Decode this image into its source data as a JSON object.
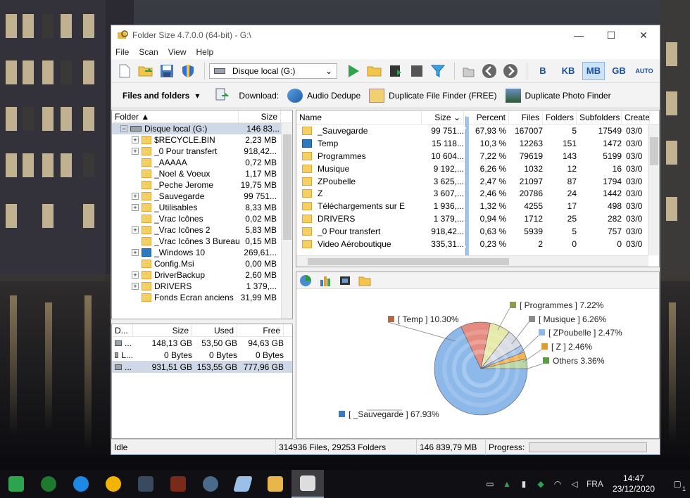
{
  "window": {
    "title": "Folder Size 4.7.0.0 (64-bit) - G:\\",
    "minimize": "—",
    "maximize": "☐",
    "close": "✕"
  },
  "menu": [
    "File",
    "Scan",
    "View",
    "Help"
  ],
  "toolbar": {
    "drive_selected": "Disque local (G:)",
    "units": [
      "B",
      "KB",
      "MB",
      "GB",
      "AUTO"
    ],
    "active_unit": "MB"
  },
  "subbar": {
    "view_label": "Files and folders",
    "download_label": "Download:",
    "links": [
      "Audio Dedupe",
      "Duplicate File Finder (FREE)",
      "Duplicate Photo Finder"
    ]
  },
  "tree": {
    "headers": {
      "folder": "Folder",
      "size": "Size"
    },
    "root": {
      "name": "Disque local (G:)",
      "size": "146 83..."
    },
    "items": [
      {
        "name": "$RECYCLE.BIN",
        "size": "2,23 MB",
        "exp": true,
        "blue": false
      },
      {
        "name": "_0 Pour transfert",
        "size": "918,42...",
        "exp": true,
        "blue": false
      },
      {
        "name": "_AAAAA",
        "size": "0,72 MB",
        "exp": false,
        "blue": false
      },
      {
        "name": "_Noel & Voeux",
        "size": "1,17 MB",
        "exp": false,
        "blue": false
      },
      {
        "name": "_Peche Jerome",
        "size": "19,75 MB",
        "exp": false,
        "blue": false
      },
      {
        "name": "_Sauvegarde",
        "size": "99 751...",
        "exp": true,
        "blue": false
      },
      {
        "name": "_Utilisables",
        "size": "8,33 MB",
        "exp": true,
        "blue": false
      },
      {
        "name": "_Vrac Icônes",
        "size": "0,02 MB",
        "exp": false,
        "blue": false
      },
      {
        "name": "_Vrac Icônes 2",
        "size": "5,83 MB",
        "exp": true,
        "blue": false
      },
      {
        "name": "_Vrac Icônes 3 Bureau",
        "size": "0,15 MB",
        "exp": false,
        "blue": false
      },
      {
        "name": "_Windows 10",
        "size": "269,61...",
        "exp": true,
        "blue": true
      },
      {
        "name": "Config.Msi",
        "size": "0,00 MB",
        "exp": false,
        "blue": false
      },
      {
        "name": "DriverBackup",
        "size": "2,60 MB",
        "exp": true,
        "blue": false
      },
      {
        "name": "DRIVERS",
        "size": "1 379,...",
        "exp": true,
        "blue": false
      },
      {
        "name": "Fonds Ecran anciens",
        "size": "31,99 MB",
        "exp": false,
        "blue": false
      }
    ]
  },
  "drives": {
    "headers": {
      "drive": "D...",
      "size": "Size",
      "used": "Used",
      "free": "Free"
    },
    "rows": [
      {
        "name": "...",
        "size": "148,13 GB",
        "used": "53,50 GB",
        "free": "94,63 GB"
      },
      {
        "name": "L...",
        "size": "0 Bytes",
        "used": "0 Bytes",
        "free": "0 Bytes"
      },
      {
        "name": "...",
        "size": "931,51 GB",
        "used": "153,55 GB",
        "free": "777,96 GB"
      }
    ]
  },
  "list": {
    "headers": {
      "name": "Name",
      "size": "Size",
      "percent": "Percent",
      "files": "Files",
      "folders": "Folders",
      "subfolders": "Subfolders",
      "created": "Created"
    },
    "rows": [
      {
        "name": "_Sauvegarde",
        "size": "99 751...",
        "percent": "67,93 %",
        "pct": 67.93,
        "files": "167007",
        "folders": "5",
        "subfolders": "17549",
        "created": "03/0",
        "blue": false
      },
      {
        "name": "Temp",
        "size": "15 118...",
        "percent": "10,3 %",
        "pct": 10.3,
        "files": "12263",
        "folders": "151",
        "subfolders": "1472",
        "created": "03/0",
        "blue": true
      },
      {
        "name": "Programmes",
        "size": "10 604...",
        "percent": "7,22 %",
        "pct": 7.22,
        "files": "79619",
        "folders": "143",
        "subfolders": "5199",
        "created": "03/0",
        "blue": false
      },
      {
        "name": "Musique",
        "size": "9 192,...",
        "percent": "6,26 %",
        "pct": 6.26,
        "files": "1032",
        "folders": "12",
        "subfolders": "16",
        "created": "03/0",
        "blue": false
      },
      {
        "name": "ZPoubelle",
        "size": "3 625,...",
        "percent": "2,47 %",
        "pct": 2.47,
        "files": "21097",
        "folders": "87",
        "subfolders": "1794",
        "created": "03/0",
        "blue": false
      },
      {
        "name": "Z",
        "size": "3 607,...",
        "percent": "2,46 %",
        "pct": 2.46,
        "files": "20786",
        "folders": "24",
        "subfolders": "1442",
        "created": "03/0",
        "blue": false
      },
      {
        "name": "Téléchargements sur E",
        "size": "1 936,...",
        "percent": "1,32 %",
        "pct": 1.32,
        "files": "4255",
        "folders": "17",
        "subfolders": "498",
        "created": "03/0",
        "blue": false
      },
      {
        "name": "DRIVERS",
        "size": "1 379,...",
        "percent": "0,94 %",
        "pct": 0.94,
        "files": "1712",
        "folders": "25",
        "subfolders": "282",
        "created": "03/0",
        "blue": false
      },
      {
        "name": "_0 Pour transfert",
        "size": "918,42...",
        "percent": "0,63 %",
        "pct": 0.63,
        "files": "5939",
        "folders": "5",
        "subfolders": "757",
        "created": "03/0",
        "blue": false
      },
      {
        "name": "Video Aéroboutique",
        "size": "335,31...",
        "percent": "0,23 %",
        "pct": 0.23,
        "files": "2",
        "folders": "0",
        "subfolders": "0",
        "created": "03/0",
        "blue": false
      }
    ]
  },
  "chart_data": {
    "type": "pie",
    "slices": [
      {
        "label": "[ _Sauvegarde ] 67.93%",
        "value": 67.93,
        "color": "#8db8ea"
      },
      {
        "label": "[ Temp ] 10.30%",
        "value": 10.3,
        "color": "#e58b80"
      },
      {
        "label": "[ Programmes ] 7.22%",
        "value": 7.22,
        "color": "#e7e9a8"
      },
      {
        "label": "[ Musique ] 6.26%",
        "value": 6.26,
        "color": "#d9dde3"
      },
      {
        "label": "[ ZPoubelle ] 2.47%",
        "value": 2.47,
        "color": "#a8c8f0"
      },
      {
        "label": "[ Z ] 2.46%",
        "value": 2.46,
        "color": "#f0b457"
      },
      {
        "label": "Others 3.36%",
        "value": 3.36,
        "color": "#b9d6a5"
      }
    ],
    "legend_colors": {
      "Temp": "#b66a3c",
      "Programmes": "#8d9a54",
      "Musique": "#8a8c90",
      "ZPoubelle": "#8db8ea",
      "Z": "#e39a2e",
      "Others": "#5b9a47",
      "Sauvegarde": "#3a7ac0"
    }
  },
  "status": {
    "state": "Idle",
    "counts": "314936 Files, 29253 Folders",
    "size": "146 839,79 MB",
    "progress_label": "Progress:"
  },
  "taskbar": {
    "lang": "FRA",
    "time": "14:47",
    "date": "23/12/2020",
    "notif_count": "1"
  }
}
